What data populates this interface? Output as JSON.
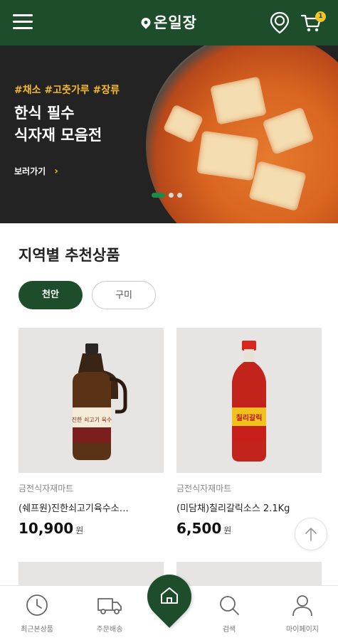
{
  "header": {
    "logo_text": "온일장",
    "cart_count": "1"
  },
  "banner": {
    "tags": "#채소 #고춧가루 #장류",
    "title_line1": "한식 필수",
    "title_line2": "식자재 모음전",
    "link_label": "보러가기",
    "slide_count": 3,
    "active_slide": 1
  },
  "section": {
    "title": "지역별 추천상품",
    "regions": [
      {
        "label": "천안",
        "selected": true
      },
      {
        "label": "구미",
        "selected": false
      }
    ]
  },
  "products": [
    {
      "store": "금전식자재마트",
      "name": "(쉐프원)진한쇠고기육수소…",
      "price": "10,900",
      "unit": "원",
      "label_text": "진한 쇠고기 육수"
    },
    {
      "store": "금전식자재마트",
      "name": "(미담채)칠리갈릭소스 2.1Kg",
      "price": "6,500",
      "unit": "원",
      "label_text": "칠리갈릭"
    }
  ],
  "bottom_nav": [
    {
      "label": "최근본상품",
      "icon": "clock-icon"
    },
    {
      "label": "주문배송",
      "icon": "truck-icon"
    },
    {
      "label": "홈",
      "icon": "home-icon"
    },
    {
      "label": "검색",
      "icon": "search-icon"
    },
    {
      "label": "마이페이지",
      "icon": "person-icon"
    }
  ],
  "colors": {
    "brand_green": "#1e4d2b",
    "accent_yellow": "#f3b929"
  }
}
